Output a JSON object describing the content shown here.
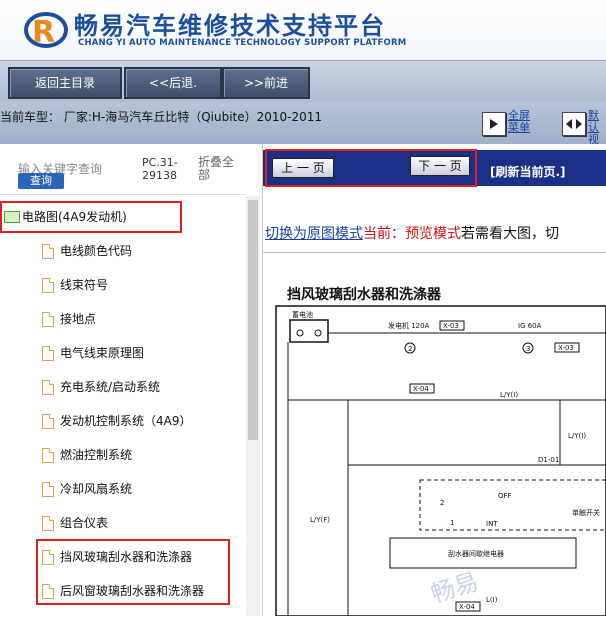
{
  "header": {
    "title": "畅易汽车维修技术支持平台",
    "subtitle": "CHANG YI AUTO MAINTENANCE TECHNOLOGY SUPPORT PLATFORM"
  },
  "toolbar": {
    "home_label": "返回主目录",
    "back_label": "<<后退.",
    "forward_label": ">>前进"
  },
  "info": {
    "car_model": "当前车型： 厂家:H-海马汽车丘比特（Qiubite）2010-2011",
    "fullscreen_label_1": "全屏",
    "fullscreen_label_2": "菜单",
    "fit_label_1": "默认",
    "fit_label_2": "视图"
  },
  "left": {
    "search_placeholder": "输入关键字查询",
    "search_button": "查询",
    "pc_code": "PC.31-29138",
    "collapse_all": "折叠全部",
    "folder_label": "电路图(4A9发动机)",
    "items": [
      "电线颜色代码",
      "线束符号",
      "接地点",
      "电气线束原理图",
      "充电系统/启动系统",
      "发动机控制系统（4A9）",
      "燃油控制系统",
      "冷却风扇系统",
      "组合仪表",
      "挡风玻璃刮水器和洗涤器",
      "后风窗玻璃刮水器和洗涤器"
    ]
  },
  "right": {
    "prev_page": "上 一 页",
    "next_page": "下 一 页",
    "refresh": "[刷新当前页.]",
    "mode_link": "切换为原图模式",
    "mode_current": "当前：预览模式",
    "mode_hint": "若需看大图，切",
    "diagram_title": "挡风玻璃刮水器和洗涤器"
  },
  "diagram": {
    "battery": "蓄电池",
    "fuse1": "发电机 120A",
    "fuse1_conn": "X-03",
    "fuse1_num": "2",
    "fuse2": "IG 60A",
    "fuse2_conn": "X-03",
    "fuse2_num": "3",
    "conn_x04": "X-04",
    "wire_ly": "L/Y(I)",
    "wire_ly2": "L/Y(I)",
    "diode": "D1-01",
    "wire_lyf": "L/Y(F)",
    "off": "OFF",
    "int": "INT",
    "num2": "2",
    "num1": "1",
    "relay": "刮水器间歇继电器",
    "single_touch": "单触开关",
    "conn_bottom": "X-04",
    "wire_bottom": "L(I)"
  },
  "watermark": "畅易"
}
